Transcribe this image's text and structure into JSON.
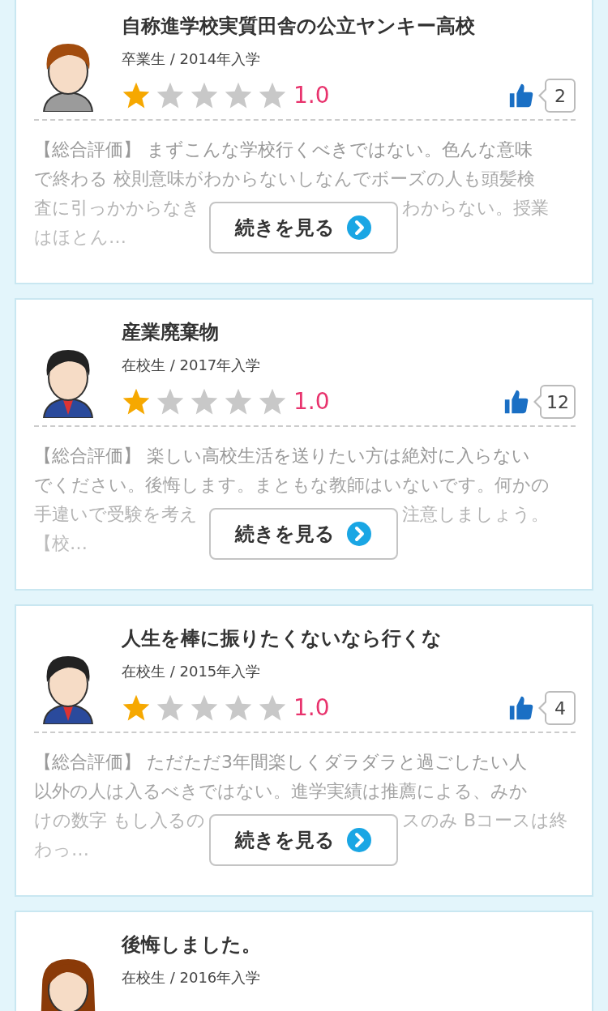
{
  "reviews": [
    {
      "avatar": {
        "kind": "casual"
      },
      "title": "自称進学校実質田舎の公立ヤンキー高校",
      "meta": "卒業生 / 2014年入学",
      "stars": 1,
      "rating": "1.0",
      "likes": "2",
      "excerpt": {
        "lines": [
          "【総合評価】 まずこんな学校行くべきではない。色んな意味",
          "で終わる 校則意味がわからないしなんでボーズの人も頭髪検"
        ],
        "covered_before": "査に引っかからなき",
        "covered_after": "わからない。授業",
        "last_line": "はほとん…"
      },
      "more_button": "続きを見る"
    },
    {
      "avatar": {
        "kind": "uniform"
      },
      "title": "産業廃棄物",
      "meta": "在校生 / 2017年入学",
      "stars": 1,
      "rating": "1.0",
      "likes": "12",
      "excerpt": {
        "lines": [
          "【総合評価】 楽しい高校生活を送りたい方は絶対に入らない",
          "でください。後悔します。まともな教師はいないです。何かの"
        ],
        "covered_before": "手違いで受験を考え",
        "covered_after": "注意しましょう。",
        "last_line": "【校…"
      },
      "more_button": "続きを見る"
    },
    {
      "avatar": {
        "kind": "uniform"
      },
      "title": "人生を棒に振りたくないなら行くな",
      "meta": "在校生 / 2015年入学",
      "stars": 1,
      "rating": "1.0",
      "likes": "4",
      "excerpt": {
        "lines": [
          "【総合評価】 ただただ3年間楽しくダラダラと過ごしたい人",
          "以外の人は入るべきではない。進学実績は推薦による、みか"
        ],
        "covered_before": "けの数字 もし入るの",
        "covered_after": "スのみ Bコースは終",
        "last_line": "わっ…"
      },
      "more_button": "続きを見る"
    },
    {
      "avatar": {
        "kind": "girl"
      },
      "title": "後悔しました。",
      "meta": "在校生 / 2016年入学"
    }
  ]
}
